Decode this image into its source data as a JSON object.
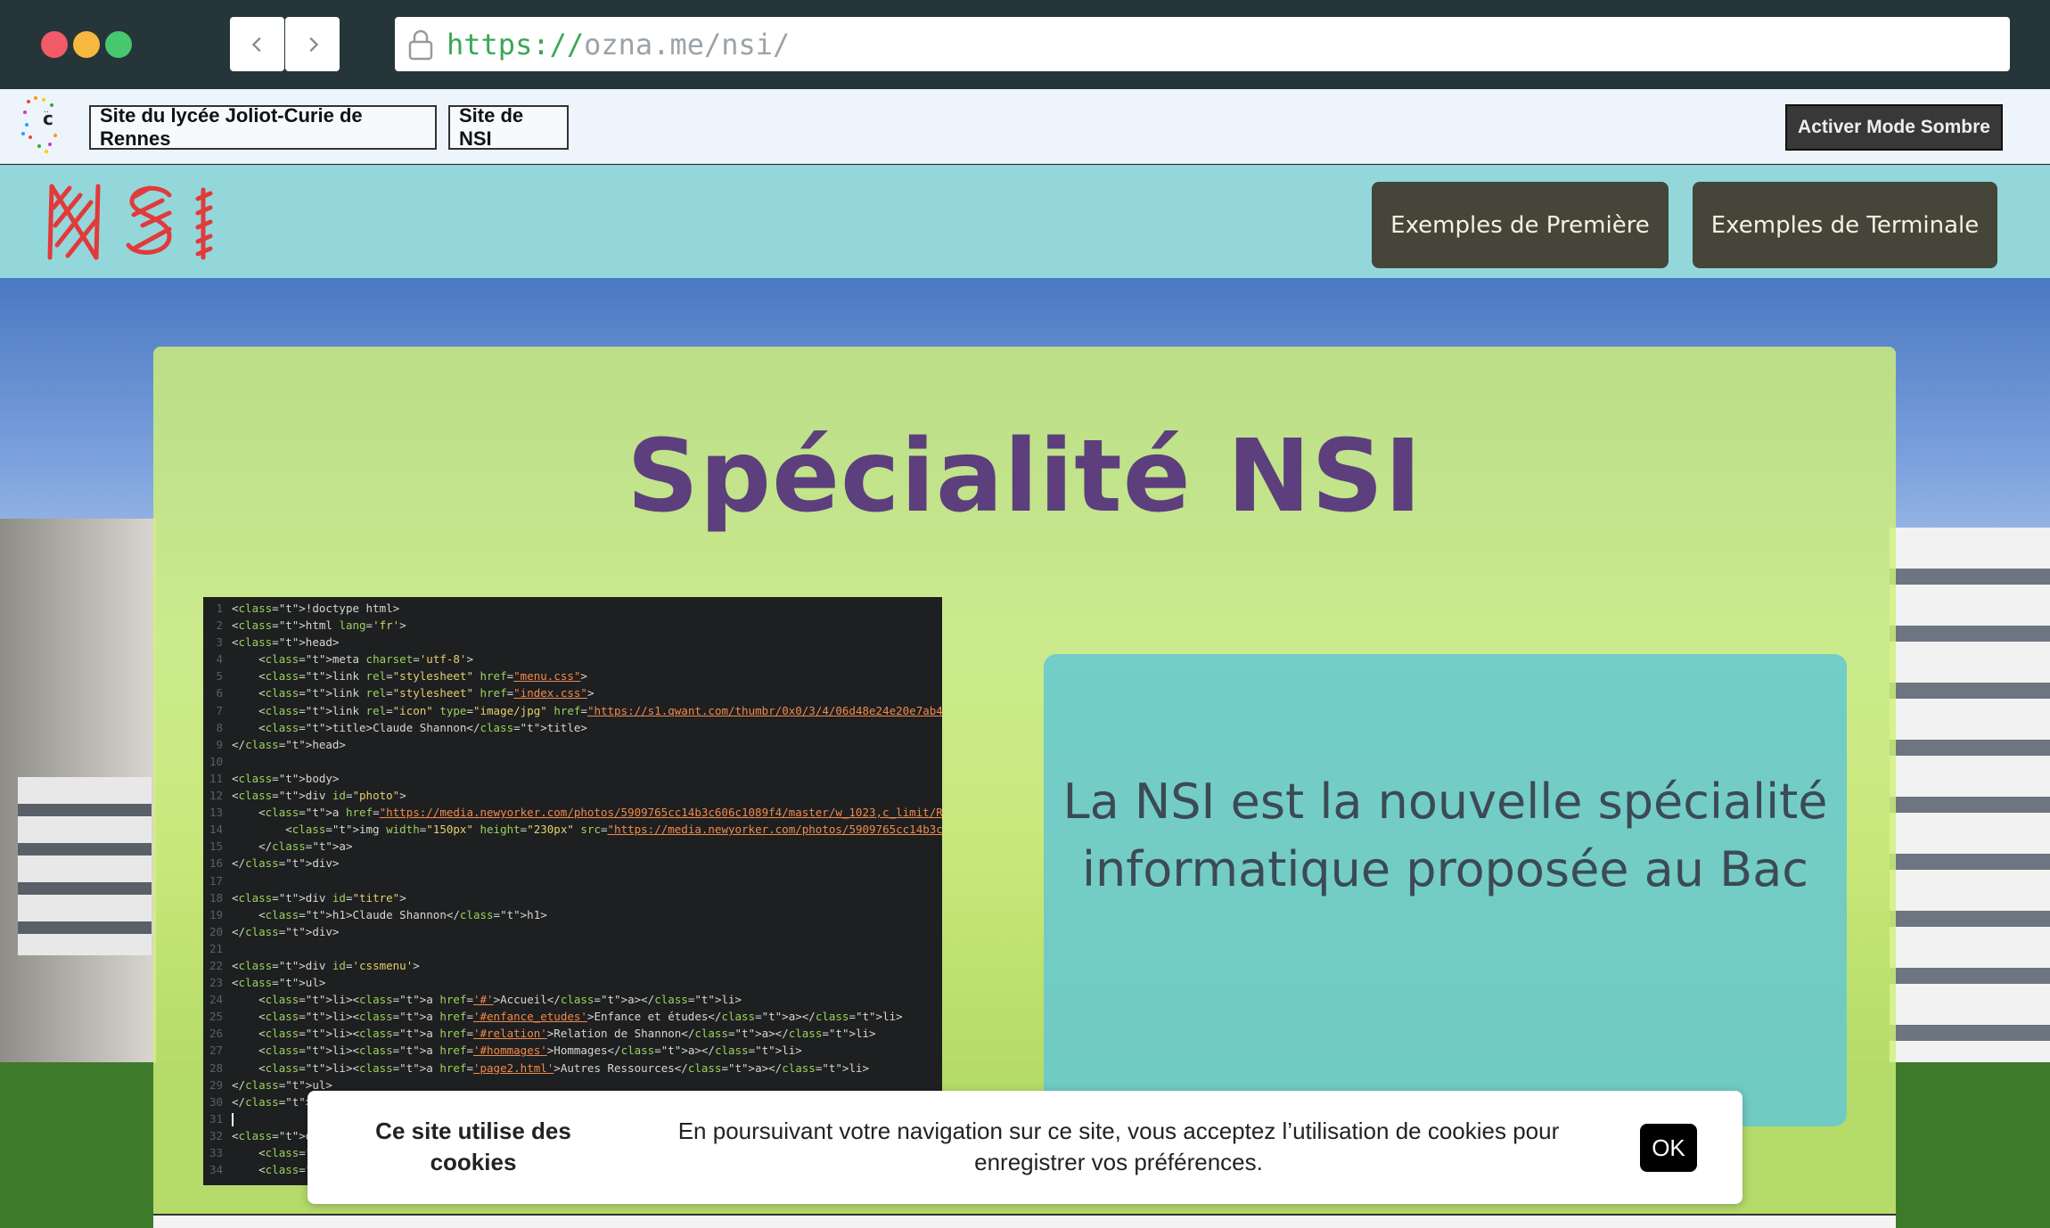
{
  "browser": {
    "url_scheme": "https://",
    "url_rest": "ozna.me/nsi/",
    "icons": {
      "back": "chevron-left-icon",
      "forward": "chevron-right-icon",
      "lock": "lock-icon"
    }
  },
  "topbar": {
    "link_lycee": "Site du lycée Joliot-Curie de Rennes",
    "link_nsi": "Site de NSI",
    "dark_mode_button": "Activer Mode Sombre"
  },
  "nav": {
    "premiere": "Exemples de Première",
    "terminale": "Exemples de Terminale"
  },
  "hero": {
    "title": "Spécialité NSI",
    "info_text": "La NSI est la nouvelle spécialité informatique proposée au Bac"
  },
  "code_screenshot": {
    "lines": [
      "<!doctype html>",
      "<html lang='fr'>",
      "<head>",
      "    <meta charset='utf-8'>",
      "    <link rel=\"stylesheet\" href=\"menu.css\">",
      "    <link rel=\"stylesheet\" href=\"index.css\">",
      "    <link rel=\"icon\" type=\"image/jpg\" href=\"https://s1.qwant.com/thumbr/0x0/3/4/06d48e24e20e7ab47015b52",
      "    <title>Claude Shannon</title>",
      "</head>",
      "",
      "<body>",
      "<div id=\"photo\">",
      "    <a href=\"https://media.newyorker.com/photos/5909765cc14b3c606c1089f4/master/w_1023,c_limit/Roberts-",
      "        <img width=\"150px\" height=\"230px\" src=\"https://media.newyorker.com/photos/5909765cc14b3c606c1089",
      "    </a>",
      "</div>",
      "",
      "<div id=\"titre\">",
      "    <h1>Claude Shannon</h1>",
      "</div>",
      "",
      "<div id='cssmenu'>",
      "<ul>",
      "    <li><a href='#'>Accueil</a></li>",
      "    <li><a href='#enfance_etudes'>Enfance et études</a></li>",
      "    <li><a href='#relation'>Relation de Shannon</a></li>",
      "    <li><a href='#hommages'>Hommages</a></li>",
      "    <li><a href='page2.html'>Autres Ressources</a></li>",
      "</ul>",
      "</div>",
      "",
      "<div class",
      "    <h2>Enf",
      "    <p>Les"
    ]
  },
  "cookie": {
    "title": "Ce site utilise des cookies",
    "text": "En poursuivant votre navigation sur ce site, vous acceptez l’utilisation de cookies pour enregistrer vos préférences.",
    "ok": "OK"
  },
  "colors": {
    "nav_band": "#93d7db",
    "menu_button": "#46453a",
    "card": "#d0f078",
    "title": "#5c3f7c",
    "info_box": "#64c8d2"
  }
}
